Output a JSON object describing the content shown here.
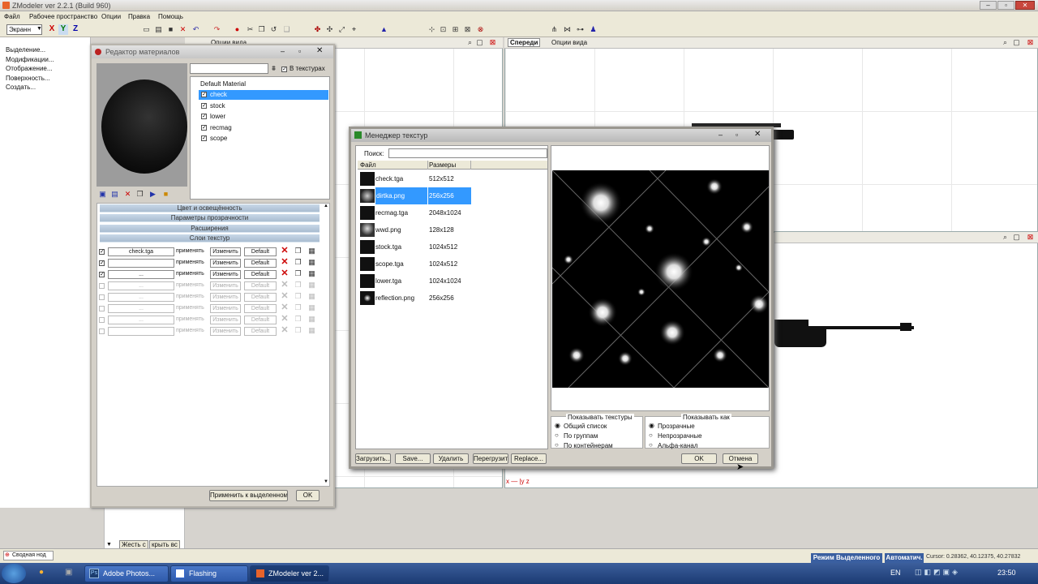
{
  "app": {
    "title": "ZModeler ver 2.2.1 (Build 960)",
    "menu": [
      "Файл",
      "Рабочее пространство",
      "Опции",
      "Правка",
      "Помощь"
    ]
  },
  "toolbar": {
    "view_select": "Экранн",
    "axes": [
      "X",
      "Y",
      "Z"
    ]
  },
  "left_panel": {
    "items": [
      "Выделение...",
      "Модификации...",
      "Отображение...",
      "Поверхность...",
      "Создать..."
    ]
  },
  "viewports": {
    "top_left_options": "Опции вида",
    "front_label": "Спереди",
    "front_options": "Опции вида",
    "axis_label": "x — |y z"
  },
  "material_editor": {
    "title": "Редактор материалов",
    "in_textures_label": "В текстурах",
    "search_value": "",
    "materials": [
      {
        "name": "Default Material",
        "checked": false,
        "selected": false
      },
      {
        "name": "check",
        "checked": true,
        "selected": true
      },
      {
        "name": "stock",
        "checked": true,
        "selected": false
      },
      {
        "name": "lower",
        "checked": true,
        "selected": false
      },
      {
        "name": "recmag",
        "checked": true,
        "selected": false
      },
      {
        "name": "scope",
        "checked": true,
        "selected": false
      }
    ],
    "sections": [
      "Цвет и освещённость",
      "Параметры прозрачности",
      "Расширения",
      "Слои текстур"
    ],
    "layers": [
      {
        "enabled": true,
        "texture": "check.tga",
        "apply": "применять",
        "change": "Изменить",
        "mode": "Default",
        "active": true
      },
      {
        "enabled": true,
        "texture": "",
        "apply": "применять",
        "change": "Изменить",
        "mode": "Default",
        "active": true
      },
      {
        "enabled": true,
        "texture": "...",
        "apply": "применять",
        "change": "Изменить",
        "mode": "Default",
        "active": true
      },
      {
        "enabled": false,
        "texture": "...",
        "apply": "применять",
        "change": "Изменить",
        "mode": "Default",
        "active": false
      },
      {
        "enabled": false,
        "texture": "...",
        "apply": "применять",
        "change": "Изменить",
        "mode": "Default",
        "active": false
      },
      {
        "enabled": false,
        "texture": "...",
        "apply": "применять",
        "change": "Изменить",
        "mode": "Default",
        "active": false
      },
      {
        "enabled": false,
        "texture": "...",
        "apply": "применять",
        "change": "Изменить",
        "mode": "Default",
        "active": false
      },
      {
        "enabled": false,
        "texture": "",
        "apply": "применять",
        "change": "Изменить",
        "mode": "Default",
        "active": false
      }
    ],
    "apply_selected_button": "Применить к выделенному",
    "ok_button": "OK"
  },
  "texture_manager": {
    "title": "Менеджер текстур",
    "search_label": "Поиск:",
    "search_value": "",
    "col_file": "Файл",
    "col_size": "Размеры",
    "files": [
      {
        "name": "check.tga",
        "size": "512x512",
        "selected": false
      },
      {
        "name": "dirtka.png",
        "size": "256x256",
        "selected": true
      },
      {
        "name": "recmag.tga",
        "size": "2048x1024",
        "selected": false
      },
      {
        "name": "wwd.png",
        "size": "128x128",
        "selected": false
      },
      {
        "name": "stock.tga",
        "size": "1024x512",
        "selected": false
      },
      {
        "name": "scope.tga",
        "size": "1024x512",
        "selected": false
      },
      {
        "name": "lower.tga",
        "size": "1024x1024",
        "selected": false
      },
      {
        "name": "reflection.png",
        "size": "256x256",
        "selected": false
      }
    ],
    "show_textures_label": "Показывать текстуры",
    "show_textures_options": [
      {
        "label": "Общий список",
        "checked": true
      },
      {
        "label": "По группам",
        "checked": false
      },
      {
        "label": "По контейнерам",
        "checked": false
      }
    ],
    "show_as_label": "Показывать как",
    "show_as_options": [
      {
        "label": "Прозрачные",
        "checked": true
      },
      {
        "label": "Непрозрачные",
        "checked": false
      },
      {
        "label": "Альфа-канал",
        "checked": false
      }
    ],
    "buttons": {
      "load": "Загрузить...",
      "save": "Save...",
      "delete": "Удалить",
      "reload": "Перегрузить",
      "replace": "Replace...",
      "ok": "OK",
      "cancel": "Отмена"
    }
  },
  "lower_panel": {
    "tab_a": "Жесть с",
    "tab_b": "крыть вс"
  },
  "status_bar": {
    "left_item": "Сводная нод",
    "mode": "Режим Выделенного",
    "auto": "Автоматич.",
    "cursor": "Cursor: 0.28362, 40.12375, 40.27832"
  },
  "taskbar": {
    "tasks": [
      "Adobe Photos...",
      "Flashing",
      "ZModeler ver 2..."
    ],
    "lang": "EN",
    "clock": "23:50"
  }
}
